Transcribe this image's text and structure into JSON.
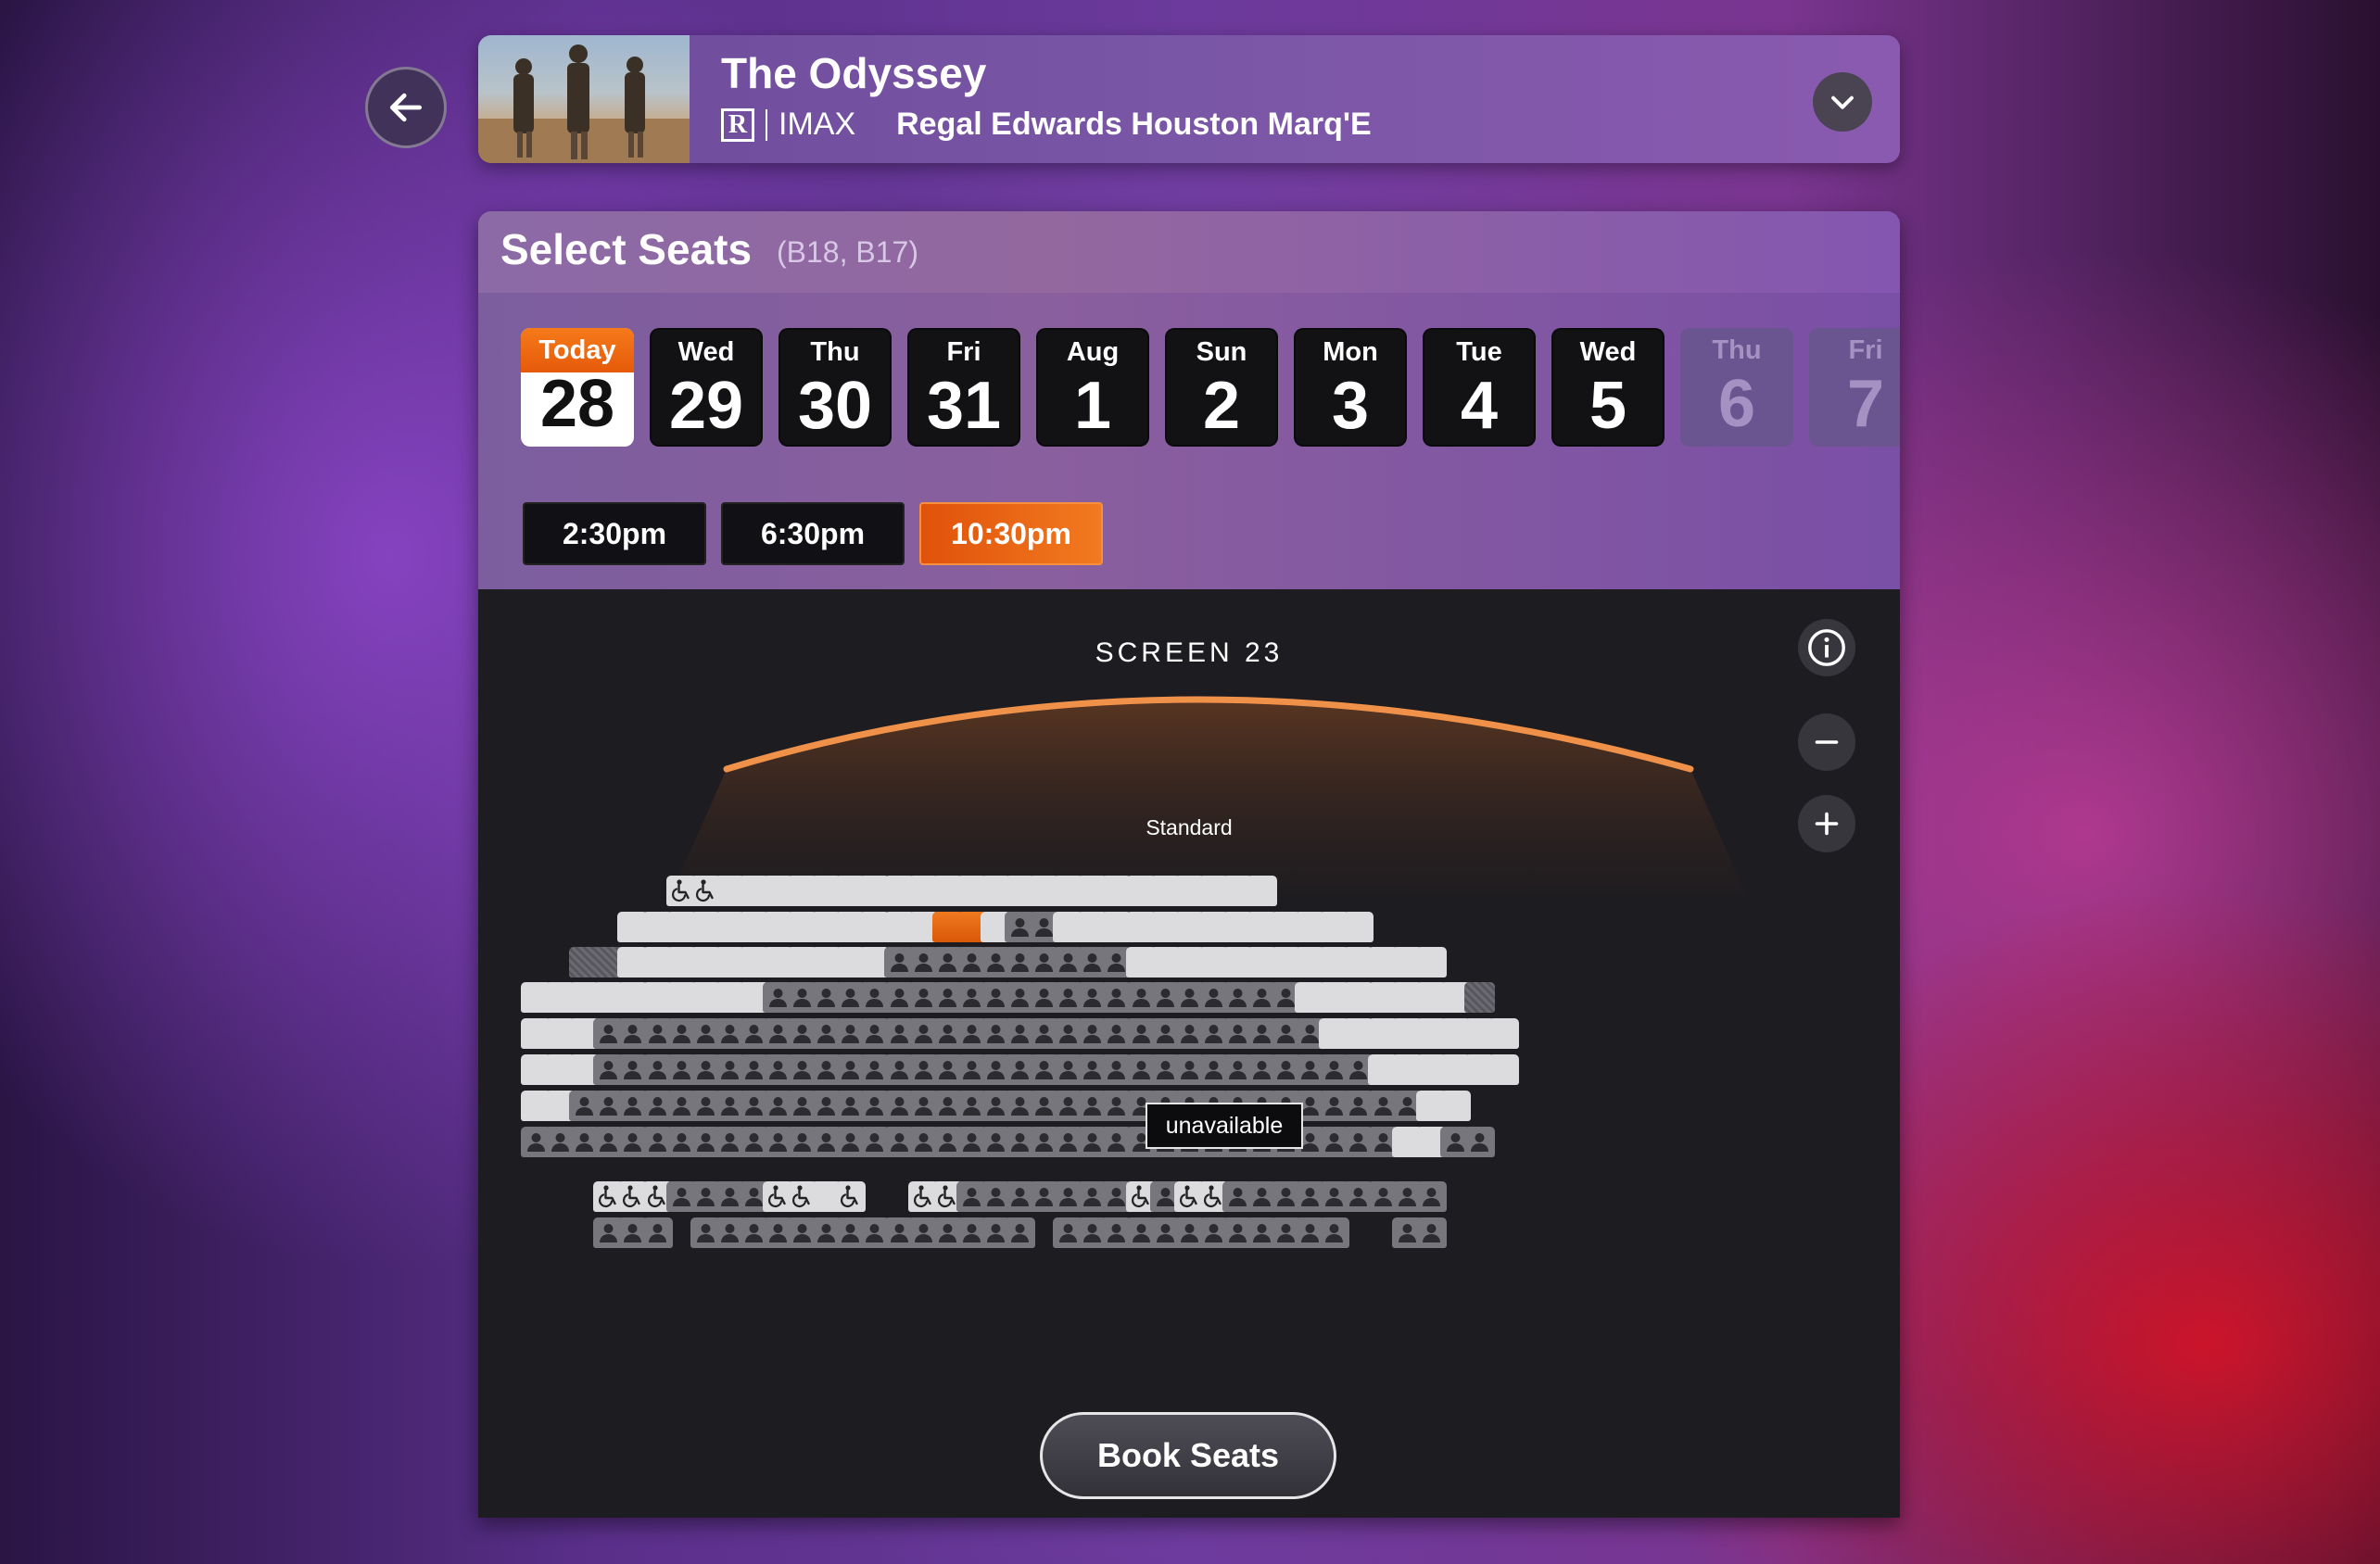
{
  "movie": {
    "title": "The Odyssey",
    "rating": "R",
    "format": "IMAX",
    "theater": "Regal Edwards Houston Marq'E"
  },
  "select_seats": {
    "title": "Select Seats",
    "selected": "(B18, B17)"
  },
  "dates": [
    {
      "dow": "Today",
      "day": "28",
      "state": "today"
    },
    {
      "dow": "Wed",
      "day": "29",
      "state": "available"
    },
    {
      "dow": "Thu",
      "day": "30",
      "state": "available"
    },
    {
      "dow": "Fri",
      "day": "31",
      "state": "available"
    },
    {
      "dow": "Aug",
      "day": "1",
      "state": "available"
    },
    {
      "dow": "Sun",
      "day": "2",
      "state": "available"
    },
    {
      "dow": "Mon",
      "day": "3",
      "state": "available"
    },
    {
      "dow": "Tue",
      "day": "4",
      "state": "available"
    },
    {
      "dow": "Wed",
      "day": "5",
      "state": "available"
    },
    {
      "dow": "Thu",
      "day": "6",
      "state": "disabled"
    },
    {
      "dow": "Fri",
      "day": "7",
      "state": "disabled"
    }
  ],
  "showtimes": [
    {
      "label": "2:30pm",
      "active": false
    },
    {
      "label": "6:30pm",
      "active": false
    },
    {
      "label": "10:30pm",
      "active": true
    }
  ],
  "screen": {
    "label": "SCREEN 23",
    "section": "Standard"
  },
  "seat_legend": {
    "a": "available",
    "s": "selected",
    "t": "taken",
    "b": "blocked",
    "w": "wheelchair-accessible",
    ".": "no seat"
  },
  "seat_rows": [
    "......wwaaaaaaaaaaaaaaaaaaaaaaa..........",
    "....aaaaaaaaaaaaassattaaaaaaaaaaaaa......",
    "..bbaaaaaaaaaaattttttttttaaaaaaaaaaaaa...",
    "aaaaaaaaaattttttttttttttttttttttaaaaaaab.",
    "aaattttttttttttttttttttttttttttttaaaaaaaa",
    "aaattttttttttttttttttttttttttttttttaaaaaa",
    "aatttttttttttttttttttttttttttttttttttaa..",
    "ttttttttttttttttttttttttttttttttttttaatt.",
    "...wwwttttwwaw..wwtttttttwtwwttttttttt...",
    "...ttt.tttttttttttttt.tttttttttttt..tt..."
  ],
  "tooltip": "unavailable",
  "book_button": "Book Seats",
  "icons": {
    "back": "arrow-left-icon",
    "dropdown": "chevron-down-icon",
    "info": "info-icon",
    "zoom_out": "minus-icon",
    "zoom_in": "plus-icon",
    "taken_seat": "person-icon",
    "wheelchair_seat": "wheelchair-icon"
  },
  "colors": {
    "accent": "#f07a20",
    "screen_arc": "#f0914a"
  }
}
